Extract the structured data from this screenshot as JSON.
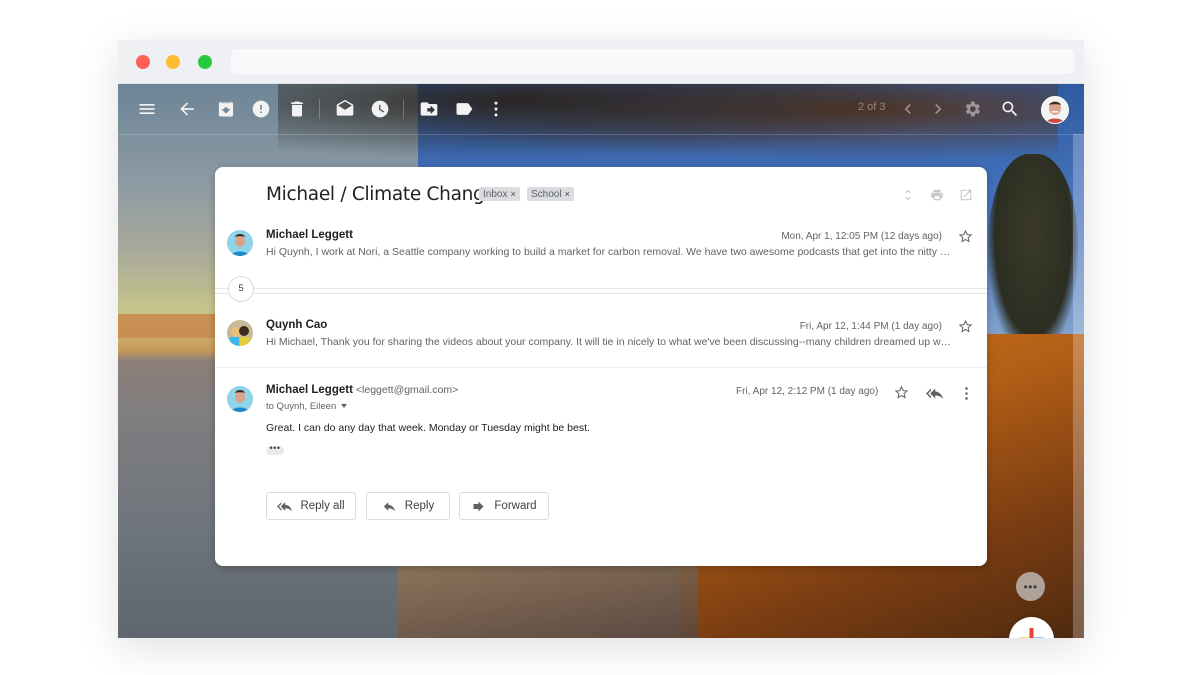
{
  "window": {
    "traffic_lights": [
      "close",
      "minimize",
      "maximize"
    ]
  },
  "toolbar": {
    "icons": [
      "menu-icon",
      "back-arrow-icon",
      "archive-icon",
      "report-spam-icon",
      "delete-icon",
      "mark-unread-icon",
      "snooze-icon",
      "move-to-icon",
      "label-icon",
      "more-vert-icon"
    ],
    "pager": "2 of 3",
    "right_icons": [
      "chevron-left-icon",
      "chevron-right-icon",
      "settings-icon",
      "search-icon"
    ]
  },
  "thread": {
    "subject": "Michael / Climate Change",
    "labels": [
      {
        "name": "Inbox",
        "remove": "×"
      },
      {
        "name": "School",
        "remove": "×"
      }
    ],
    "header_icons": [
      "expand-all-icon",
      "print-icon",
      "open-new-window-icon"
    ],
    "collapsed_count": "5",
    "messages": [
      {
        "sender": "Michael Leggett",
        "date": "Mon, Apr 1, 12:05 PM (12 days ago)",
        "snippet": "Hi Quynh, I work at Nori, a Seattle company working to build a market for carbon removal. We have two awesome podcasts that get into the nitty …"
      },
      {
        "sender": "Quynh Cao",
        "date": "Fri, Apr 12, 1:44 PM (1 day ago)",
        "snippet": "Hi Michael, Thank you for sharing the videos about your company. It will tie in nicely to what we've been discussing--many children dreamed up w…"
      },
      {
        "sender": "Michael Leggett",
        "email": "<leggett@gmail.com>",
        "to": "to Quynh, Eileen",
        "date": "Fri, Apr 12, 2:12 PM (1 day ago)",
        "body": "Great. I can do any day that week. Monday or Tuesday might be best.",
        "trimmed": "•••"
      }
    ],
    "actions": {
      "reply_all": "Reply all",
      "reply": "Reply",
      "forward": "Forward"
    }
  },
  "fab": {
    "more": "•••",
    "compose": "+"
  },
  "colors": {
    "compose_red": "#ea4335",
    "compose_blue": "#4285f4",
    "compose_green": "#34a853",
    "compose_yellow": "#fbbc04"
  }
}
